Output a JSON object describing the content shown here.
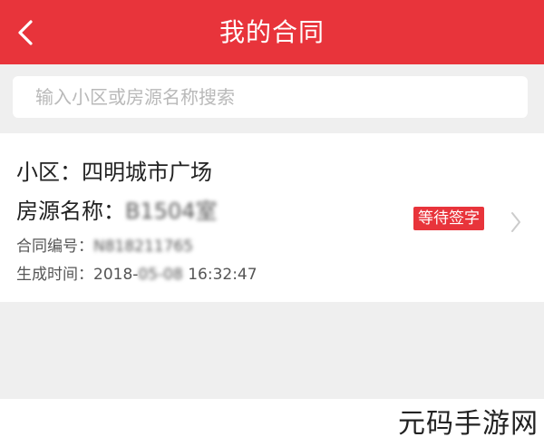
{
  "header": {
    "title": "我的合同",
    "back_icon": "chevron-left-icon"
  },
  "search": {
    "placeholder": "输入小区或房源名称搜索",
    "value": ""
  },
  "contract": {
    "community_label": "小区：",
    "community_value": "四明城市广场",
    "house_label": "房源名称：",
    "house_value": "B1504室",
    "contract_no_label": "合同编号：",
    "contract_no_value": "N818211765",
    "time_label": "生成时间：",
    "time_prefix": "2018-",
    "time_blurred": "05-08",
    "time_suffix": " 16:32:47",
    "status": "等待签字",
    "chevron_icon": "chevron-right-icon"
  },
  "watermark": "元码手游网",
  "colors": {
    "accent": "#e8343b",
    "background": "#efefef",
    "card": "#ffffff"
  }
}
